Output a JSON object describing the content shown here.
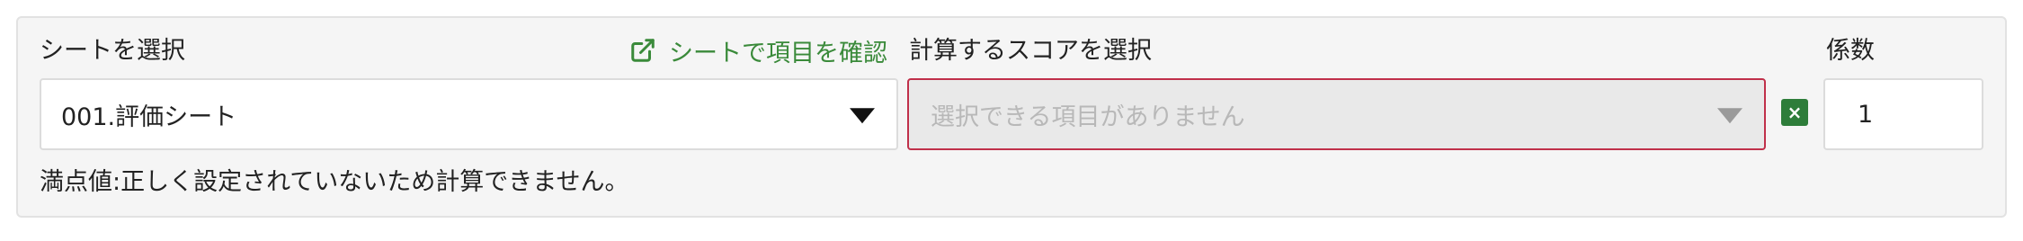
{
  "sheet": {
    "label": "シートを選択",
    "selected": "001.評価シート",
    "confirm_link": "シートで項目を確認"
  },
  "score": {
    "label": "計算するスコアを選択",
    "placeholder": "選択できる項目がありません",
    "clear_symbol": "×"
  },
  "coefficient": {
    "label": "係数",
    "value": "1"
  },
  "message": "満点値:正しく設定されていないため計算できません。",
  "colors": {
    "accent_green": "#3a8a3a",
    "error_border": "#c0304a"
  }
}
